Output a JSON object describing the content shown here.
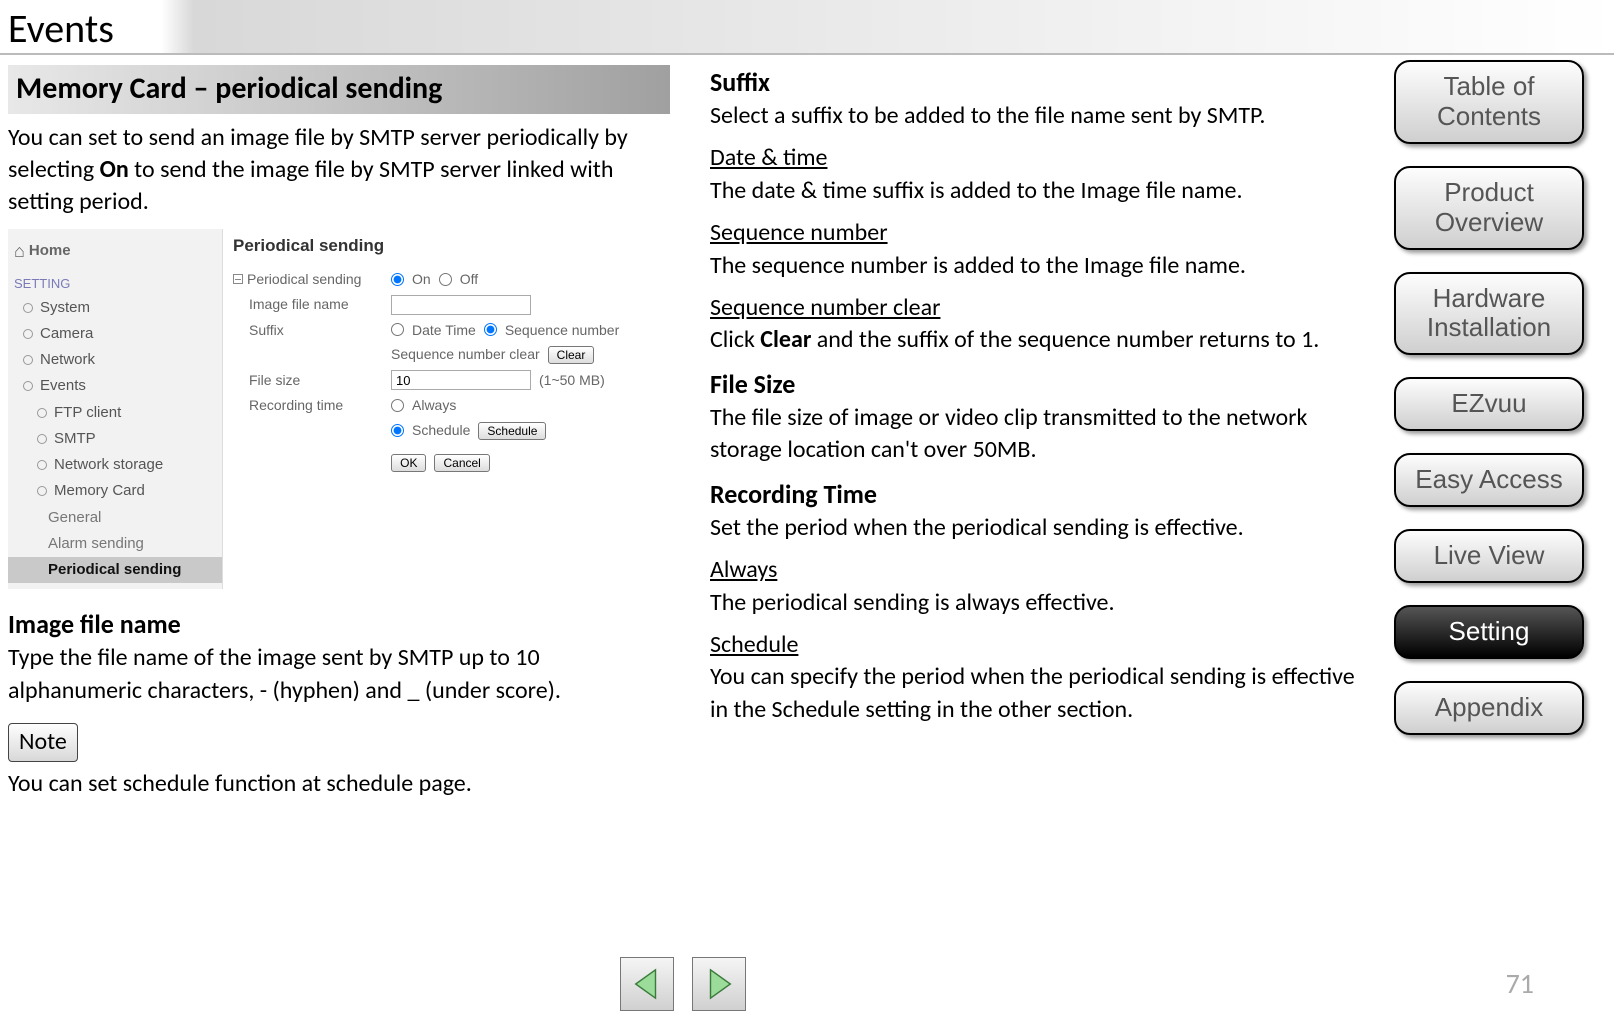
{
  "page_title": "Events",
  "page_number": "71",
  "left_column": {
    "section_title": "Memory Card – periodical sending",
    "intro_pre": "You can set to send an image file by SMTP server periodically by selecting ",
    "intro_bold": "On",
    "intro_post": " to send the image file by SMTP server linked with setting period.",
    "image_file_name_hdr": "Image file name",
    "image_file_name_body": "Type the file name of the image sent by SMTP up to 10 alphanumeric characters, - (hyphen) and _ (under score).",
    "note_label": "Note",
    "note_body": "You can set schedule function at schedule page."
  },
  "right_column": {
    "suffix_hdr": "Suffix",
    "suffix_body": "Select a suffix to be added to the file name sent by SMTP.",
    "date_time_hdr": "Date & time",
    "date_time_body": "The date & time suffix is added to the Image file name.",
    "seq_hdr": "Sequence number",
    "seq_body": "The sequence number is added to the Image file name.",
    "seq_clear_hdr": "Sequence number clear",
    "seq_clear_pre": "Click ",
    "seq_clear_bold": "Clear",
    "seq_clear_post": " and the suffix of the sequence number returns to 1.",
    "filesize_hdr": "File Size",
    "filesize_body": "The file size of image or video clip transmitted to the network storage location can't over 50MB.",
    "rectime_hdr": "Recording Time",
    "rectime_body": "Set the period when the periodical sending is effective.",
    "always_hdr": "Always",
    "always_body": "The periodical sending is always effective.",
    "schedule_hdr": "Schedule",
    "schedule_body": "You can specify the period when the periodical sending is effective in the Schedule setting in the other section."
  },
  "nav_tabs": {
    "toc": "Table of Contents",
    "product": "Product Overview",
    "hardware": "Hardware Installation",
    "ezvuu": "EZvuu",
    "easy": "Easy Access",
    "live": "Live View",
    "setting": "Setting",
    "appendix": "Appendix"
  },
  "mock": {
    "home": "Home",
    "setting": "SETTING",
    "system": "System",
    "camera": "Camera",
    "network": "Network",
    "events": "Events",
    "ftp": "FTP client",
    "smtp": "SMTP",
    "netstorage": "Network storage",
    "memcard": "Memory Card",
    "general": "General",
    "alarm": "Alarm sending",
    "periodical": "Periodical sending",
    "main_hdr": "Periodical sending",
    "row_periodical": "Periodical sending",
    "opt_on": "On",
    "opt_off": "Off",
    "row_imgfile": "Image file name",
    "row_suffix": "Suffix",
    "opt_datetime": "Date Time",
    "opt_seqnum": "Sequence number",
    "row_seqclear": "Sequence number clear",
    "btn_clear": "Clear",
    "row_filesize": "File size",
    "filesize_value": "10",
    "filesize_hint": "(1~50 MB)",
    "row_rectime": "Recording time",
    "opt_always": "Always",
    "opt_schedule": "Schedule",
    "btn_schedule": "Schedule",
    "btn_ok": "OK",
    "btn_cancel": "Cancel"
  }
}
